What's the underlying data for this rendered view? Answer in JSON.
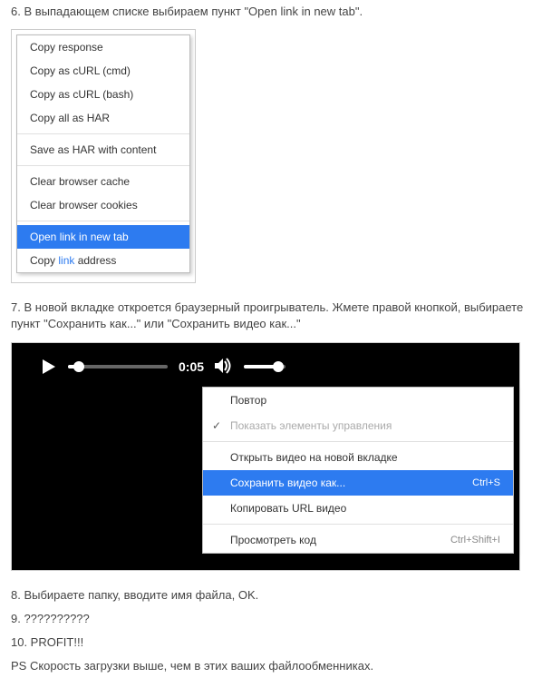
{
  "steps": {
    "s6": "6. В выпадающем списке выбираем пункт \"Open link in new tab\".",
    "s7": "7. В новой вкладке откроется браузерный проигрыватель. Жмете правой кнопкой, выбираете пункт \"Сохранить как...\" или \"Сохранить видео как...\"",
    "s8": "8. Выбираете папку, вводите имя файла, OK.",
    "s9": "9. ??????????",
    "s10": "10. PROFIT!!!",
    "ps": "PS Скорость загрузки выше, чем в этих ваших файлообменниках."
  },
  "menu1": {
    "items": [
      {
        "label": "Copy response"
      },
      {
        "label": "Copy as cURL (cmd)"
      },
      {
        "label": "Copy as cURL (bash)"
      },
      {
        "label": "Copy all as HAR"
      },
      {
        "sep": true
      },
      {
        "label": "Save as HAR with content"
      },
      {
        "sep": true
      },
      {
        "label": "Clear browser cache"
      },
      {
        "label": "Clear browser cookies"
      },
      {
        "sep": true
      },
      {
        "label": "Open link in new tab",
        "selected": true
      },
      {
        "label_html": [
          "Copy ",
          "link",
          " address"
        ]
      }
    ]
  },
  "player": {
    "time": "0:05"
  },
  "menu2": {
    "items": [
      {
        "label": "Повтор"
      },
      {
        "label": "Показать элементы управления",
        "checked": true,
        "disabled": true
      },
      {
        "sep": true
      },
      {
        "label": "Открыть видео на новой вкладке"
      },
      {
        "label": "Сохранить видео как...",
        "shortcut": "Ctrl+S",
        "selected": true
      },
      {
        "label": "Копировать URL видео"
      },
      {
        "sep": true
      },
      {
        "label": "Просмотреть код",
        "shortcut": "Ctrl+Shift+I",
        "shortcut_dim": true
      }
    ]
  }
}
